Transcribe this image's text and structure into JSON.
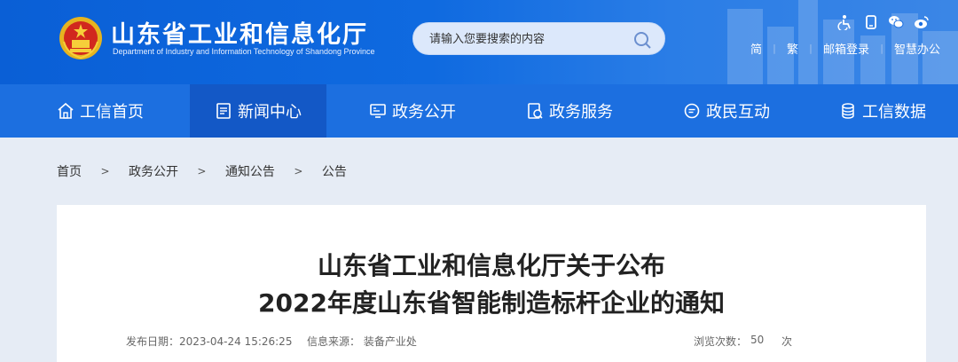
{
  "header": {
    "title": "山东省工业和信息化厅",
    "subtitle": "Department of Industry and Information Technology of Shandong Province",
    "search_placeholder": "请输入您要搜索的内容",
    "icons": [
      "accessibility-icon",
      "mobile-icon",
      "wechat-icon",
      "weibo-icon"
    ],
    "links": {
      "simplified": "简",
      "traditional": "繁",
      "mail_login": "邮箱登录",
      "smart_office": "智慧办公"
    },
    "separator": "|"
  },
  "nav": {
    "items": [
      {
        "label": "工信首页",
        "icon": "home-icon"
      },
      {
        "label": "新闻中心",
        "icon": "news-icon",
        "active": true
      },
      {
        "label": "政务公开",
        "icon": "monitor-icon"
      },
      {
        "label": "政务服务",
        "icon": "service-icon"
      },
      {
        "label": "政民互动",
        "icon": "chat-icon"
      },
      {
        "label": "工信数据",
        "icon": "database-icon"
      }
    ]
  },
  "breadcrumb": {
    "items": [
      "首页",
      "政务公开",
      "通知公告",
      "公告"
    ],
    "separator": ">"
  },
  "article": {
    "title_line1": "山东省工业和信息化厅关于公布",
    "title_line2": "2022年度山东省智能制造标杆企业的通知",
    "publish_date": "发布日期：2023-04-24 15:26:25",
    "source": "信息来源：  装备产业处",
    "views_label": "浏览次数：",
    "views_count": "50",
    "views_unit": "次"
  },
  "colors": {
    "header_blue": "#0f6ae0",
    "nav_blue": "#1c6fe0",
    "nav_active": "#1358c6",
    "page_bg": "#e6ecf5"
  }
}
